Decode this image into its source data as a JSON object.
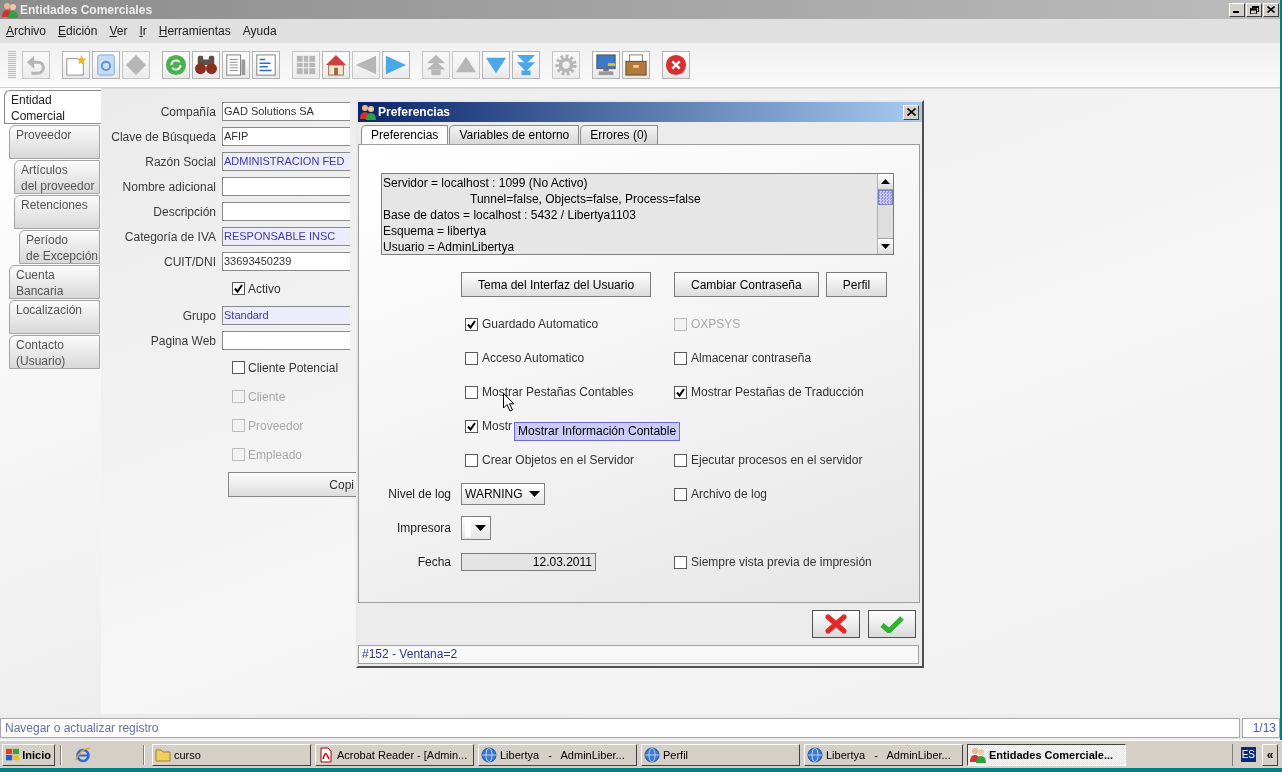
{
  "window": {
    "title": "Entidades Comerciales"
  },
  "menu": [
    {
      "label": "Archivo",
      "mnemonic": true
    },
    {
      "label": "Edición",
      "mnemonic": true
    },
    {
      "label": "Ver",
      "mnemonic": true
    },
    {
      "label": "Ir",
      "mnemonic": true
    },
    {
      "label": "Herramientas",
      "mnemonic": true
    },
    {
      "label": "Ayuda",
      "mnemonic": false
    }
  ],
  "toolbar": {
    "groups": [
      {
        "tools": [
          {
            "kind": "undo",
            "disabled": true
          }
        ]
      },
      {
        "tools": [
          {
            "kind": "new",
            "disabled": false
          },
          {
            "kind": "copy",
            "disabled": false
          },
          {
            "kind": "delete",
            "disabled": true
          }
        ]
      },
      {
        "tools": [
          {
            "kind": "refresh",
            "disabled": false
          },
          {
            "kind": "find",
            "disabled": false
          },
          {
            "kind": "report",
            "disabled": false
          },
          {
            "kind": "form",
            "disabled": false
          }
        ]
      },
      {
        "tools": [
          {
            "kind": "grid",
            "disabled": true
          },
          {
            "kind": "home",
            "disabled": false
          },
          {
            "kind": "back",
            "disabled": true
          },
          {
            "kind": "forward",
            "disabled": false
          }
        ]
      },
      {
        "tools": [
          {
            "kind": "first",
            "disabled": true
          },
          {
            "kind": "previous",
            "disabled": true
          },
          {
            "kind": "next",
            "disabled": false
          },
          {
            "kind": "last",
            "disabled": false
          }
        ]
      },
      {
        "tools": [
          {
            "kind": "process",
            "disabled": true
          }
        ]
      },
      {
        "tools": [
          {
            "kind": "computer",
            "disabled": false
          },
          {
            "kind": "archive",
            "disabled": false
          }
        ]
      },
      {
        "tools": [
          {
            "kind": "exit",
            "disabled": false
          }
        ]
      }
    ]
  },
  "tabs": [
    {
      "label": "Entidad\nComercial",
      "selected": true,
      "children": [
        {
          "label": "Proveedor",
          "selected": false,
          "children": [
            {
              "label": "Artículos\ndel proveedor",
              "selected": false
            },
            {
              "label": "Retenciones",
              "selected": false,
              "children": [
                {
                  "label": "Período\nde Excepción",
                  "selected": false
                }
              ]
            }
          ]
        },
        {
          "label": "Cuenta\nBancaria",
          "selected": false
        },
        {
          "label": "Localización",
          "selected": false
        },
        {
          "label": "Contacto\n(Usuario)",
          "selected": false
        }
      ]
    }
  ],
  "form": [
    {
      "kind": "field",
      "label": "Compañía",
      "value": "GAD Solutions SA",
      "mandatory": false
    },
    {
      "kind": "field",
      "label": "Clave de Búsqueda",
      "value": "AFIP",
      "mandatory": false
    },
    {
      "kind": "field",
      "label": "Razón Social",
      "value": "ADMINISTRACION FED",
      "mandatory": true
    },
    {
      "kind": "field",
      "label": "Nombre adicional",
      "mandatory": false
    },
    {
      "kind": "field",
      "label": "Descripción",
      "mandatory": false
    },
    {
      "kind": "field",
      "label": "Categoría de IVA",
      "value": "RESPONSABLE INSC",
      "mandatory": true
    },
    {
      "kind": "field",
      "label": "CUIT/DNI",
      "value": "33693450239",
      "mandatory": false
    },
    {
      "kind": "checkbox",
      "label": "Activo",
      "checked": true,
      "disabled": false
    },
    {
      "kind": "field",
      "label": "Grupo",
      "value": "Standard",
      "mandatory": true
    },
    {
      "kind": "field",
      "label": "Pagina Web",
      "mandatory": false
    },
    {
      "kind": "checkbox",
      "label": "Cliente Potencial",
      "checked": false,
      "disabled": false
    },
    {
      "kind": "checkbox",
      "label": "Cliente",
      "checked": false,
      "disabled": true
    },
    {
      "kind": "checkbox",
      "label": "Proveedor",
      "checked": false,
      "disabled": true
    },
    {
      "kind": "checkbox",
      "label": "Empleado",
      "checked": false,
      "disabled": true
    },
    {
      "kind": "button",
      "label": "Copi"
    }
  ],
  "dialog": {
    "title": "Preferencias",
    "tabs": [
      {
        "label": "Preferencias",
        "selected": true
      },
      {
        "label": "Variables de entorno",
        "selected": false
      },
      {
        "label": "Errores (0)",
        "selected": false
      }
    ],
    "info_text": "Servidor = localhost : 1099 (No Activo)\n\t\t\tTunnel=false, Objects=false, Process=false\nBase de datos = localhost : 5432 / Libertya1103\nEsquema = libertya\nUsuario = AdminLibertya",
    "button_row": {
      "left": [
        "Tema del Interfaz del Usuario"
      ],
      "right": [
        "Cambiar Contraseña",
        "Perfil"
      ]
    },
    "options": [
      {
        "left": {
          "kind": "checkbox",
          "label": "Guardado Automatico",
          "checked": true,
          "disabled": false
        },
        "right": {
          "kind": "checkbox",
          "label": "OXPSYS",
          "checked": false,
          "disabled": true
        }
      },
      {
        "left": {
          "kind": "checkbox",
          "label": "Acceso Automatico",
          "checked": false,
          "disabled": false
        },
        "right": {
          "kind": "checkbox",
          "label": "Almacenar contraseña",
          "checked": false,
          "disabled": false
        }
      },
      {
        "left": {
          "kind": "checkbox",
          "label": "Mostrar Pestañas Contables",
          "checked": false,
          "disabled": false
        },
        "right": {
          "kind": "checkbox",
          "label": "Mostrar Pestañas de Traducción",
          "checked": true,
          "disabled": false
        }
      },
      {
        "left": {
          "kind": "checkbox",
          "label": "Mostr",
          "checked": true,
          "disabled": false
        }
      },
      {
        "left": {
          "kind": "checkbox",
          "label": "Crear Objetos en el Servidor",
          "checked": false,
          "disabled": false
        },
        "right": {
          "kind": "checkbox",
          "label": "Ejecutar procesos en el servidor",
          "checked": false,
          "disabled": false
        }
      },
      {
        "left": {
          "kind": "dropdown",
          "label": "Nivel de log",
          "value": "WARNING"
        },
        "right": {
          "kind": "checkbox",
          "label": "Archivo de log",
          "checked": false,
          "disabled": false
        }
      },
      {
        "left": {
          "kind": "dropdown",
          "label": "Impresora"
        }
      },
      {
        "left": {
          "kind": "date",
          "label": "Fecha",
          "value": "12.03.2011"
        },
        "right": {
          "kind": "checkbox",
          "label": "Siempre vista previa de impresión",
          "checked": false,
          "disabled": false
        }
      }
    ],
    "tooltip": "Mostrar Información Contable",
    "actions": [
      {
        "kind": "cancel"
      },
      {
        "kind": "ok"
      }
    ],
    "status": "#152 - Ventana=2"
  },
  "status_bar": {
    "message": "Navegar o actualizar registro",
    "record": "1/13"
  },
  "taskbar": {
    "start": "Inicio",
    "tasks": [
      {
        "label": "curso",
        "kind": "folder",
        "selected": false
      },
      {
        "label": "Acrobat Reader - [Admin...",
        "kind": "document",
        "selected": false
      },
      {
        "label": "Libertya   -   AdminLiber...",
        "kind": "globe",
        "selected": false
      },
      {
        "label": "Perfil",
        "kind": "globe",
        "selected": false
      },
      {
        "label": "Libertya   -   AdminLiber...",
        "kind": "globe",
        "selected": false
      },
      {
        "label": "Entidades Comerciale...",
        "kind": "app",
        "selected": true
      }
    ],
    "tray": {
      "language": "ES",
      "toggle": "«"
    }
  }
}
